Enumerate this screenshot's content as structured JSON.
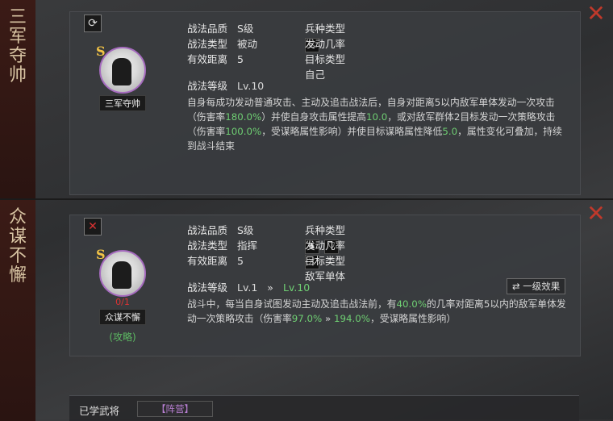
{
  "skills": [
    {
      "side_title": "三军夺帅",
      "corner_icon": "refresh-icon",
      "grade": "S",
      "name_tag": "三军夺帅",
      "quality_label": "战法品质",
      "quality_value": "S级",
      "arm_label": "兵种类型",
      "arm_icons": [
        "bow-icon"
      ],
      "type_label": "战法类型",
      "type_value": "被动",
      "rate_label": "发动几率",
      "rate_value": "--",
      "range_label": "有效距离",
      "range_value": "5",
      "target_label": "目标类型",
      "target_value": "自己",
      "level_label": "战法等级",
      "level_value": "Lv.10",
      "desc": [
        {
          "t": "自身每成功发动普通攻击、主动及追击战法后，自身对距离5以内敌军单体发动一次攻击（伤害率"
        },
        {
          "t": "180.0%",
          "g": true
        },
        {
          "t": "）并使自身攻击属性提高"
        },
        {
          "t": "10.0",
          "g": true
        },
        {
          "t": "，或对敌军群体2目标发动一次策略攻击（伤害率"
        },
        {
          "t": "100.0%",
          "g": true
        },
        {
          "t": "，受谋略属性影响）并使目标谋略属性降低"
        },
        {
          "t": "5.0",
          "g": true
        },
        {
          "t": "，属性变化可叠加，持续到战斗结束"
        }
      ]
    },
    {
      "side_title": "众谋不懈",
      "corner_icon": "close-icon",
      "grade": "S",
      "name_tag": "众谋不懈",
      "count": "0/1",
      "category": "(攻略)",
      "quality_label": "战法品质",
      "quality_value": "S级",
      "arm_label": "兵种类型",
      "arm_icons": [
        "horse-icon",
        "shield-icon",
        "bow-icon"
      ],
      "type_label": "战法类型",
      "type_value": "指挥",
      "rate_label": "发动几率",
      "rate_value": "--",
      "range_label": "有效距离",
      "range_value": "5",
      "target_label": "目标类型",
      "target_value": "敌军单体",
      "level_label": "战法等级",
      "level_value": "Lv.1",
      "level_arrow": "»",
      "level_next": "Lv.10",
      "effect_button": "⇄ 一级效果",
      "desc": [
        {
          "t": "战斗中，每当自身试图发动主动及追击战法前，有"
        },
        {
          "t": "40.0%",
          "g": true
        },
        {
          "t": "的几率对距离5以内的敌军单体发动一次策略攻击（伤害率"
        },
        {
          "t": "97.0%",
          "g": true
        },
        {
          "t": " » "
        },
        {
          "t": "194.0%",
          "g": true
        },
        {
          "t": "，受谋略属性影响）"
        }
      ]
    }
  ],
  "learned": {
    "label": "已学武将",
    "tag": "【阵营】"
  },
  "close_symbol": "✕",
  "colors": {
    "accent_green": "#6fcf73",
    "grade_gold": "#f3c446",
    "close_red": "#c0392b"
  }
}
